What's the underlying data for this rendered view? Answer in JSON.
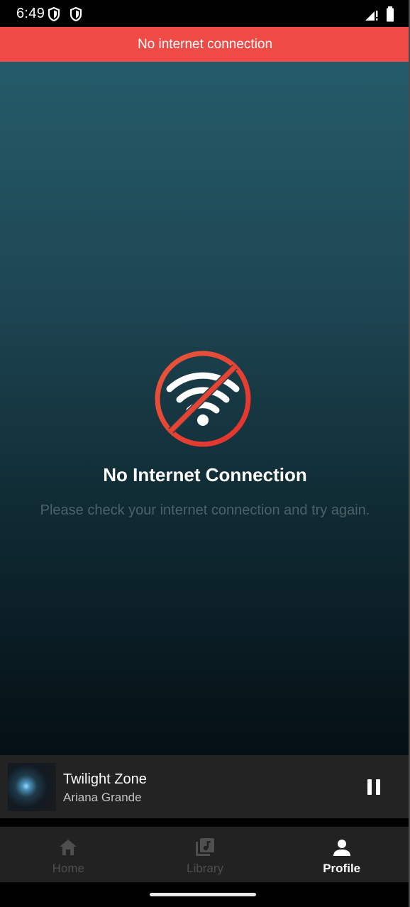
{
  "status_bar": {
    "time": "6:49"
  },
  "banner": {
    "text": "No internet connection",
    "color": "#ef4a45"
  },
  "empty_state": {
    "icon": "wifi-off-icon",
    "title": "No Internet Connection",
    "message": "Please check your internet connection and try again."
  },
  "mini_player": {
    "title": "Twilight Zone",
    "artist": "Ariana Grande",
    "control_icon": "pause-icon"
  },
  "nav": {
    "items": [
      {
        "label": "Home",
        "icon": "home-icon",
        "active": false
      },
      {
        "label": "Library",
        "icon": "library-music-icon",
        "active": false
      },
      {
        "label": "Profile",
        "icon": "person-icon",
        "active": true
      }
    ]
  }
}
